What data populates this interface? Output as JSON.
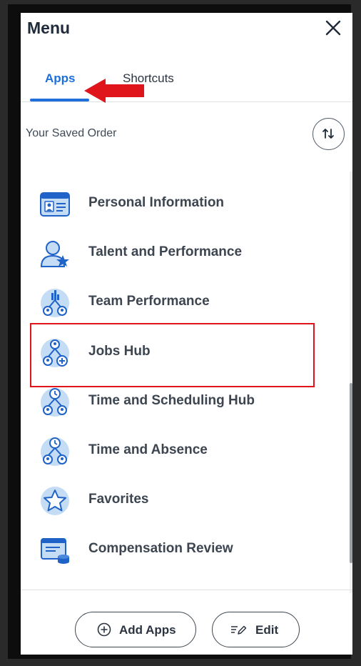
{
  "header": {
    "title": "Menu",
    "close_icon": "close-icon"
  },
  "tabs": [
    {
      "label": "Apps",
      "active": true
    },
    {
      "label": "Shortcuts",
      "active": false
    }
  ],
  "saved_order": {
    "label": "Your Saved Order",
    "sort_icon": "sort-arrows-icon"
  },
  "apps": [
    {
      "label": "Personal Information",
      "icon": "id-card-icon"
    },
    {
      "label": "Talent and Performance",
      "icon": "person-star-icon"
    },
    {
      "label": "Team Performance",
      "icon": "team-chart-icon"
    },
    {
      "label": "Jobs Hub",
      "icon": "team-plus-icon"
    },
    {
      "label": "Time and Scheduling Hub",
      "icon": "team-clock-icon"
    },
    {
      "label": "Time and Absence",
      "icon": "team-clock-icon"
    },
    {
      "label": "Favorites",
      "icon": "star-icon"
    },
    {
      "label": "Compensation Review",
      "icon": "document-coin-icon"
    }
  ],
  "footer": {
    "add_apps_label": "Add Apps",
    "edit_label": "Edit"
  },
  "colors": {
    "accent": "#1e6fd9",
    "annotation_red": "#e0141b",
    "icon_light": "#c5dcf5",
    "icon_dark": "#1f63c8"
  }
}
